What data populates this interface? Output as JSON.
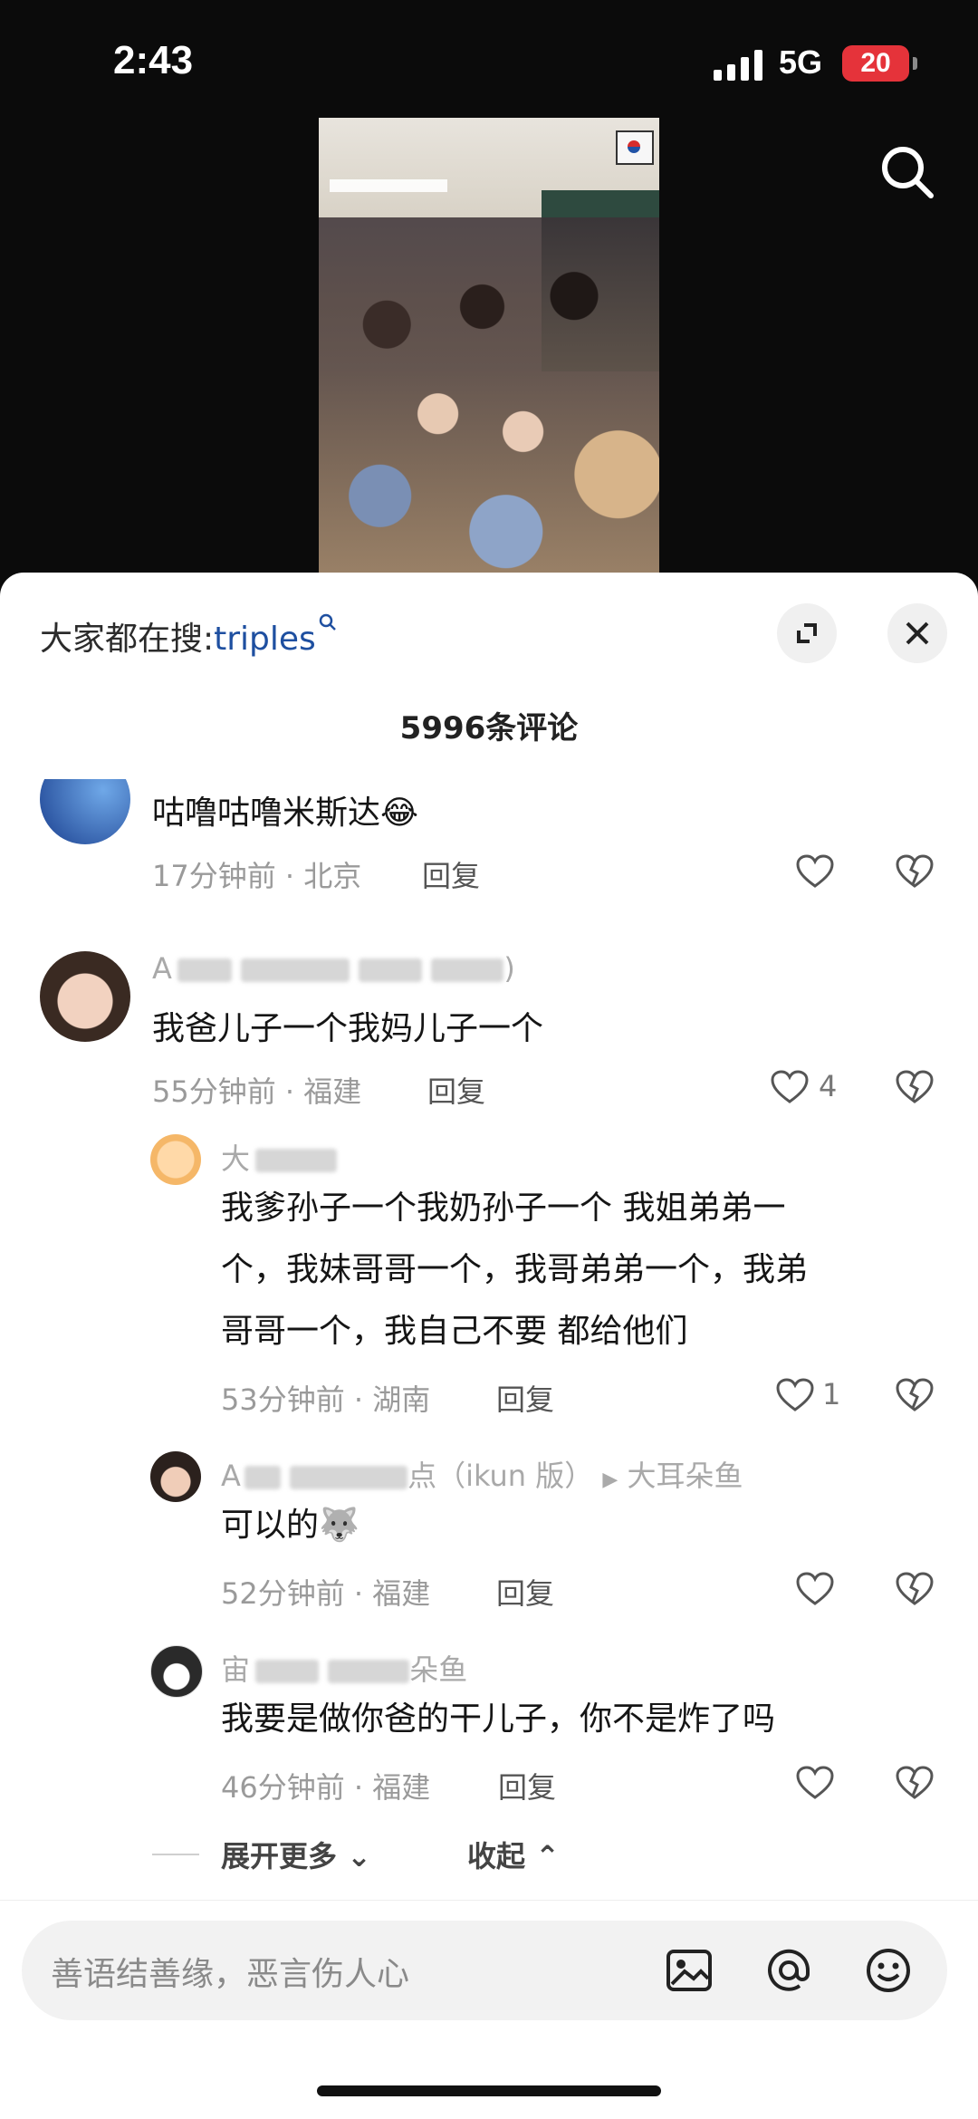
{
  "status": {
    "time": "2:43",
    "network": "5G",
    "battery": "20"
  },
  "sheet": {
    "trend_prefix": "大家都在搜:",
    "trend_query": "triples",
    "comment_count": "5996条评论"
  },
  "comments": [
    {
      "text": "咕噜咕噜米斯达😂",
      "time_loc": "17分钟前 · 北京",
      "reply": "回复",
      "likes": ""
    },
    {
      "username": "A▪ ▪▪▪ ▪ ▪▪▪版)",
      "text": "我爸儿子一个我妈儿子一个",
      "time_loc": "55分钟前 · 福建",
      "reply": "回复",
      "likes": "4"
    },
    {
      "username": "大▪▪鱼",
      "text_lines": [
        "我爹孙子一个我奶孙子一个 我姐弟弟一",
        "个，我妹哥哥一个，我哥弟弟一个，我弟",
        "哥哥一个，我自己不要 都给他们"
      ],
      "time_loc": "53分钟前 · 湖南",
      "reply": "回复",
      "likes": "1"
    },
    {
      "username": "A▪ ▪▪▪点（ikun 版）",
      "reply_to": "大耳朵鱼",
      "text": "可以的🐺",
      "time_loc": "52分钟前 · 福建",
      "reply": "回复",
      "likes": ""
    },
    {
      "username": "宙▪ ▪▪朵鱼",
      "text": "我要是做你爸的干儿子，你不是炸了吗",
      "time_loc": "46分钟前 · 福建",
      "reply": "回复",
      "likes": ""
    }
  ],
  "thread_controls": {
    "more": "展开更多",
    "collapse": "收起"
  },
  "input": {
    "placeholder": "善语结善缘，恶言伤人心"
  },
  "colors": {
    "accent_link": "#1e4fa0",
    "battery_low": "#e5333a"
  }
}
